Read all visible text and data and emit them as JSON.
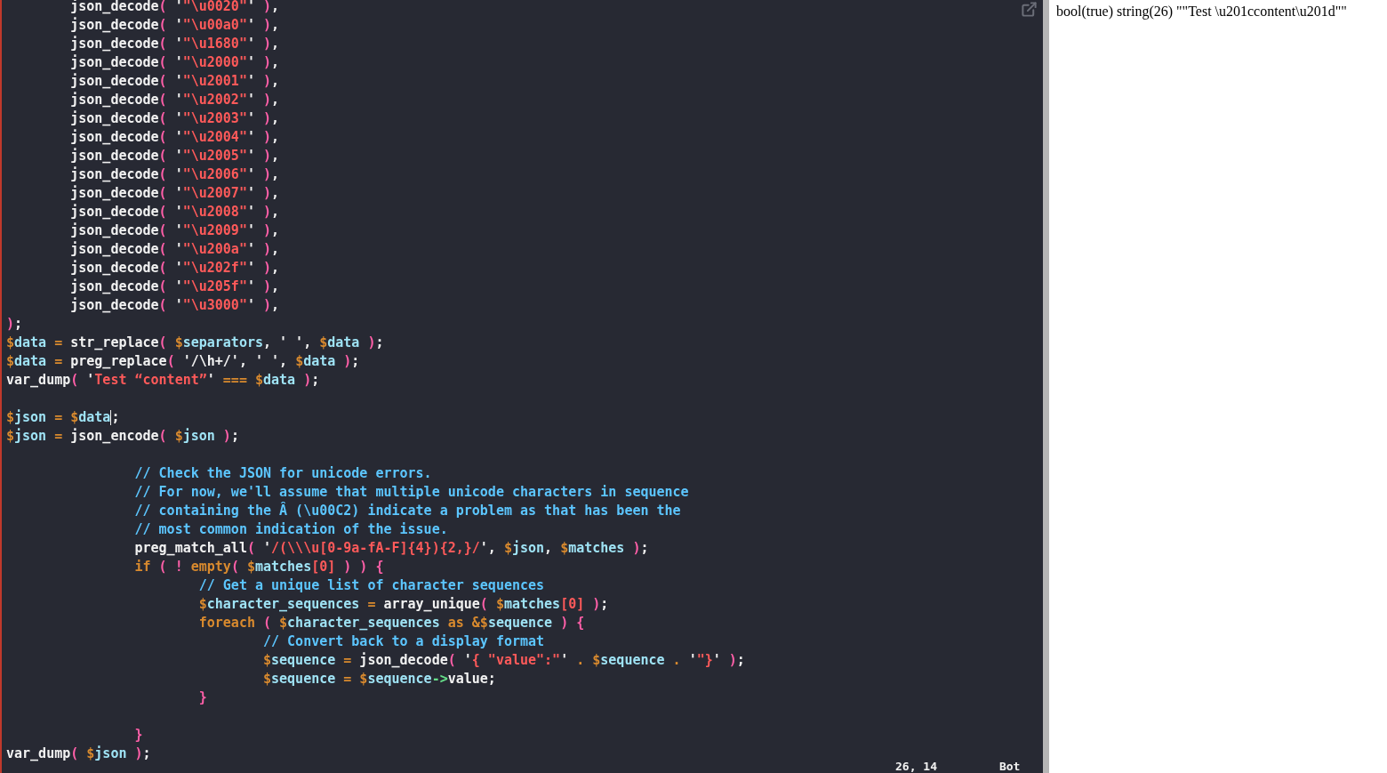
{
  "editor": {
    "lines": [
      {
        "tokens": [
          {
            "kind": "fn",
            "text": "\tjson_decode"
          },
          {
            "kind": "p",
            "text": "("
          },
          {
            "kind": "plain",
            "text": " '"
          },
          {
            "kind": "s",
            "text": "\"\\u0020\""
          },
          {
            "kind": "plain",
            "text": "' "
          },
          {
            "kind": "p",
            "text": ")"
          },
          {
            "kind": "plain",
            "text": ","
          }
        ]
      },
      {
        "tokens": [
          {
            "kind": "fn",
            "text": "\tjson_decode"
          },
          {
            "kind": "p",
            "text": "("
          },
          {
            "kind": "plain",
            "text": " '"
          },
          {
            "kind": "s",
            "text": "\"\\u00a0\""
          },
          {
            "kind": "plain",
            "text": "' "
          },
          {
            "kind": "p",
            "text": ")"
          },
          {
            "kind": "plain",
            "text": ","
          }
        ]
      },
      {
        "tokens": [
          {
            "kind": "fn",
            "text": "\tjson_decode"
          },
          {
            "kind": "p",
            "text": "("
          },
          {
            "kind": "plain",
            "text": " '"
          },
          {
            "kind": "s",
            "text": "\"\\u1680\""
          },
          {
            "kind": "plain",
            "text": "' "
          },
          {
            "kind": "p",
            "text": ")"
          },
          {
            "kind": "plain",
            "text": ","
          }
        ]
      },
      {
        "tokens": [
          {
            "kind": "fn",
            "text": "\tjson_decode"
          },
          {
            "kind": "p",
            "text": "("
          },
          {
            "kind": "plain",
            "text": " '"
          },
          {
            "kind": "s",
            "text": "\"\\u2000\""
          },
          {
            "kind": "plain",
            "text": "' "
          },
          {
            "kind": "p",
            "text": ")"
          },
          {
            "kind": "plain",
            "text": ","
          }
        ]
      },
      {
        "tokens": [
          {
            "kind": "fn",
            "text": "\tjson_decode"
          },
          {
            "kind": "p",
            "text": "("
          },
          {
            "kind": "plain",
            "text": " '"
          },
          {
            "kind": "s",
            "text": "\"\\u2001\""
          },
          {
            "kind": "plain",
            "text": "' "
          },
          {
            "kind": "p",
            "text": ")"
          },
          {
            "kind": "plain",
            "text": ","
          }
        ]
      },
      {
        "tokens": [
          {
            "kind": "fn",
            "text": "\tjson_decode"
          },
          {
            "kind": "p",
            "text": "("
          },
          {
            "kind": "plain",
            "text": " '"
          },
          {
            "kind": "s",
            "text": "\"\\u2002\""
          },
          {
            "kind": "plain",
            "text": "' "
          },
          {
            "kind": "p",
            "text": ")"
          },
          {
            "kind": "plain",
            "text": ","
          }
        ]
      },
      {
        "tokens": [
          {
            "kind": "fn",
            "text": "\tjson_decode"
          },
          {
            "kind": "p",
            "text": "("
          },
          {
            "kind": "plain",
            "text": " '"
          },
          {
            "kind": "s",
            "text": "\"\\u2003\""
          },
          {
            "kind": "plain",
            "text": "' "
          },
          {
            "kind": "p",
            "text": ")"
          },
          {
            "kind": "plain",
            "text": ","
          }
        ]
      },
      {
        "tokens": [
          {
            "kind": "fn",
            "text": "\tjson_decode"
          },
          {
            "kind": "p",
            "text": "("
          },
          {
            "kind": "plain",
            "text": " '"
          },
          {
            "kind": "s",
            "text": "\"\\u2004\""
          },
          {
            "kind": "plain",
            "text": "' "
          },
          {
            "kind": "p",
            "text": ")"
          },
          {
            "kind": "plain",
            "text": ","
          }
        ]
      },
      {
        "tokens": [
          {
            "kind": "fn",
            "text": "\tjson_decode"
          },
          {
            "kind": "p",
            "text": "("
          },
          {
            "kind": "plain",
            "text": " '"
          },
          {
            "kind": "s",
            "text": "\"\\u2005\""
          },
          {
            "kind": "plain",
            "text": "' "
          },
          {
            "kind": "p",
            "text": ")"
          },
          {
            "kind": "plain",
            "text": ","
          }
        ]
      },
      {
        "tokens": [
          {
            "kind": "fn",
            "text": "\tjson_decode"
          },
          {
            "kind": "p",
            "text": "("
          },
          {
            "kind": "plain",
            "text": " '"
          },
          {
            "kind": "s",
            "text": "\"\\u2006\""
          },
          {
            "kind": "plain",
            "text": "' "
          },
          {
            "kind": "p",
            "text": ")"
          },
          {
            "kind": "plain",
            "text": ","
          }
        ]
      },
      {
        "tokens": [
          {
            "kind": "fn",
            "text": "\tjson_decode"
          },
          {
            "kind": "p",
            "text": "("
          },
          {
            "kind": "plain",
            "text": " '"
          },
          {
            "kind": "s",
            "text": "\"\\u2007\""
          },
          {
            "kind": "plain",
            "text": "' "
          },
          {
            "kind": "p",
            "text": ")"
          },
          {
            "kind": "plain",
            "text": ","
          }
        ]
      },
      {
        "tokens": [
          {
            "kind": "fn",
            "text": "\tjson_decode"
          },
          {
            "kind": "p",
            "text": "("
          },
          {
            "kind": "plain",
            "text": " '"
          },
          {
            "kind": "s",
            "text": "\"\\u2008\""
          },
          {
            "kind": "plain",
            "text": "' "
          },
          {
            "kind": "p",
            "text": ")"
          },
          {
            "kind": "plain",
            "text": ","
          }
        ]
      },
      {
        "tokens": [
          {
            "kind": "fn",
            "text": "\tjson_decode"
          },
          {
            "kind": "p",
            "text": "("
          },
          {
            "kind": "plain",
            "text": " '"
          },
          {
            "kind": "s",
            "text": "\"\\u2009\""
          },
          {
            "kind": "plain",
            "text": "' "
          },
          {
            "kind": "p",
            "text": ")"
          },
          {
            "kind": "plain",
            "text": ","
          }
        ]
      },
      {
        "tokens": [
          {
            "kind": "fn",
            "text": "\tjson_decode"
          },
          {
            "kind": "p",
            "text": "("
          },
          {
            "kind": "plain",
            "text": " '"
          },
          {
            "kind": "s",
            "text": "\"\\u200a\""
          },
          {
            "kind": "plain",
            "text": "' "
          },
          {
            "kind": "p",
            "text": ")"
          },
          {
            "kind": "plain",
            "text": ","
          }
        ]
      },
      {
        "tokens": [
          {
            "kind": "fn",
            "text": "\tjson_decode"
          },
          {
            "kind": "p",
            "text": "("
          },
          {
            "kind": "plain",
            "text": " '"
          },
          {
            "kind": "s",
            "text": "\"\\u202f\""
          },
          {
            "kind": "plain",
            "text": "' "
          },
          {
            "kind": "p",
            "text": ")"
          },
          {
            "kind": "plain",
            "text": ","
          }
        ]
      },
      {
        "tokens": [
          {
            "kind": "fn",
            "text": "\tjson_decode"
          },
          {
            "kind": "p",
            "text": "("
          },
          {
            "kind": "plain",
            "text": " '"
          },
          {
            "kind": "s",
            "text": "\"\\u205f\""
          },
          {
            "kind": "plain",
            "text": "' "
          },
          {
            "kind": "p",
            "text": ")"
          },
          {
            "kind": "plain",
            "text": ","
          }
        ]
      },
      {
        "tokens": [
          {
            "kind": "fn",
            "text": "\tjson_decode"
          },
          {
            "kind": "p",
            "text": "("
          },
          {
            "kind": "plain",
            "text": " '"
          },
          {
            "kind": "s",
            "text": "\"\\u3000\""
          },
          {
            "kind": "plain",
            "text": "' "
          },
          {
            "kind": "p",
            "text": ")"
          },
          {
            "kind": "plain",
            "text": ","
          }
        ]
      },
      {
        "tokens": [
          {
            "kind": "p",
            "text": ")"
          },
          {
            "kind": "plain",
            "text": ";"
          }
        ]
      },
      {
        "tokens": [
          {
            "kind": "d",
            "text": "$"
          },
          {
            "kind": "v",
            "text": "data"
          },
          {
            "kind": "o",
            "text": " = "
          },
          {
            "kind": "fn",
            "text": "str_replace"
          },
          {
            "kind": "p",
            "text": "("
          },
          {
            "kind": "d",
            "text": " $"
          },
          {
            "kind": "v",
            "text": "separators"
          },
          {
            "kind": "plain",
            "text": ", ' ', "
          },
          {
            "kind": "d",
            "text": "$"
          },
          {
            "kind": "v",
            "text": "data"
          },
          {
            "kind": "p",
            "text": " )"
          },
          {
            "kind": "plain",
            "text": ";"
          }
        ]
      },
      {
        "tokens": [
          {
            "kind": "d",
            "text": "$"
          },
          {
            "kind": "v",
            "text": "data"
          },
          {
            "kind": "o",
            "text": " = "
          },
          {
            "kind": "fn",
            "text": "preg_replace"
          },
          {
            "kind": "p",
            "text": "("
          },
          {
            "kind": "plain",
            "text": " '/\\h+/', ' ', "
          },
          {
            "kind": "d",
            "text": "$"
          },
          {
            "kind": "v",
            "text": "data"
          },
          {
            "kind": "p",
            "text": " )"
          },
          {
            "kind": "plain",
            "text": ";"
          }
        ]
      },
      {
        "tokens": [
          {
            "kind": "fn",
            "text": "var_dump"
          },
          {
            "kind": "p",
            "text": "("
          },
          {
            "kind": "plain",
            "text": " '"
          },
          {
            "kind": "s",
            "text": "Test “content”"
          },
          {
            "kind": "plain",
            "text": "' "
          },
          {
            "kind": "o",
            "text": "==="
          },
          {
            "kind": "d",
            "text": " $"
          },
          {
            "kind": "v",
            "text": "data"
          },
          {
            "kind": "p",
            "text": " )"
          },
          {
            "kind": "plain",
            "text": ";"
          }
        ]
      },
      {
        "kind": "blank"
      },
      {
        "tokens": [
          {
            "kind": "d",
            "text": "$"
          },
          {
            "kind": "v",
            "text": "json"
          },
          {
            "kind": "o",
            "text": " = "
          },
          {
            "kind": "d",
            "text": "$"
          },
          {
            "kind": "v",
            "text": "data"
          },
          {
            "kind": "cursor"
          },
          {
            "kind": "plain",
            "text": ";"
          }
        ]
      },
      {
        "tokens": [
          {
            "kind": "d",
            "text": "$"
          },
          {
            "kind": "v",
            "text": "json"
          },
          {
            "kind": "o",
            "text": " = "
          },
          {
            "kind": "fn",
            "text": "json_encode"
          },
          {
            "kind": "p",
            "text": "("
          },
          {
            "kind": "d",
            "text": " $"
          },
          {
            "kind": "v",
            "text": "json"
          },
          {
            "kind": "p",
            "text": " )"
          },
          {
            "kind": "plain",
            "text": ";"
          }
        ]
      },
      {
        "kind": "blank"
      },
      {
        "tokens": [
          {
            "kind": "c",
            "text": "\t\t// Check the JSON for unicode errors."
          }
        ]
      },
      {
        "tokens": [
          {
            "kind": "c",
            "text": "\t\t// For now, we'll assume that multiple unicode characters in sequence"
          }
        ]
      },
      {
        "tokens": [
          {
            "kind": "c",
            "text": "\t\t// containing the Â (\\u00C2) indicate a problem as that has been the"
          }
        ]
      },
      {
        "tokens": [
          {
            "kind": "c",
            "text": "\t\t// most common indication of the issue."
          }
        ]
      },
      {
        "tokens": [
          {
            "kind": "fn",
            "text": "\t\tpreg_match_all"
          },
          {
            "kind": "p",
            "text": "("
          },
          {
            "kind": "plain",
            "text": " '"
          },
          {
            "kind": "s",
            "text": "/(\\\\\\u[0-9a-fA-F]{4}){2,}/"
          },
          {
            "kind": "plain",
            "text": "', "
          },
          {
            "kind": "d",
            "text": "$"
          },
          {
            "kind": "v",
            "text": "json"
          },
          {
            "kind": "plain",
            "text": ", "
          },
          {
            "kind": "d",
            "text": "$"
          },
          {
            "kind": "v",
            "text": "matches"
          },
          {
            "kind": "p",
            "text": " )"
          },
          {
            "kind": "plain",
            "text": ";"
          }
        ]
      },
      {
        "tokens": [
          {
            "kind": "kw",
            "text": "\t\tif"
          },
          {
            "kind": "p",
            "text": " ( ! "
          },
          {
            "kind": "kw",
            "text": "empty"
          },
          {
            "kind": "p",
            "text": "("
          },
          {
            "kind": "d",
            "text": " $"
          },
          {
            "kind": "v",
            "text": "matches"
          },
          {
            "kind": "n",
            "text": "[0]"
          },
          {
            "kind": "p",
            "text": " ) ) {"
          }
        ]
      },
      {
        "tokens": [
          {
            "kind": "c",
            "text": "\t\t\t// Get a unique list of character sequences"
          }
        ]
      },
      {
        "tokens": [
          {
            "kind": "d",
            "text": "\t\t\t$"
          },
          {
            "kind": "v",
            "text": "character_sequences"
          },
          {
            "kind": "o",
            "text": " = "
          },
          {
            "kind": "fn",
            "text": "array_unique"
          },
          {
            "kind": "p",
            "text": "("
          },
          {
            "kind": "d",
            "text": " $"
          },
          {
            "kind": "v",
            "text": "matches"
          },
          {
            "kind": "n",
            "text": "[0]"
          },
          {
            "kind": "p",
            "text": " )"
          },
          {
            "kind": "plain",
            "text": ";"
          }
        ]
      },
      {
        "tokens": [
          {
            "kind": "kw",
            "text": "\t\t\tforeach"
          },
          {
            "kind": "p",
            "text": " ("
          },
          {
            "kind": "d",
            "text": " $"
          },
          {
            "kind": "v",
            "text": "character_sequences"
          },
          {
            "kind": "kw",
            "text": " as "
          },
          {
            "kind": "o",
            "text": "&"
          },
          {
            "kind": "d",
            "text": "$"
          },
          {
            "kind": "v",
            "text": "sequence"
          },
          {
            "kind": "p",
            "text": " ) {"
          }
        ]
      },
      {
        "tokens": [
          {
            "kind": "c",
            "text": "\t\t\t\t// Convert back to a display format"
          }
        ]
      },
      {
        "tokens": [
          {
            "kind": "d",
            "text": "\t\t\t\t$"
          },
          {
            "kind": "v",
            "text": "sequence"
          },
          {
            "kind": "o",
            "text": " = "
          },
          {
            "kind": "fn",
            "text": "json_decode"
          },
          {
            "kind": "p",
            "text": "("
          },
          {
            "kind": "plain",
            "text": " '"
          },
          {
            "kind": "s",
            "text": "{ \"value\":\""
          },
          {
            "kind": "plain",
            "text": "' "
          },
          {
            "kind": "o",
            "text": ". "
          },
          {
            "kind": "d",
            "text": "$"
          },
          {
            "kind": "v",
            "text": "sequence"
          },
          {
            "kind": "o",
            "text": " . "
          },
          {
            "kind": "plain",
            "text": "'"
          },
          {
            "kind": "s",
            "text": "\"}"
          },
          {
            "kind": "plain",
            "text": "' "
          },
          {
            "kind": "p",
            "text": ")"
          },
          {
            "kind": "plain",
            "text": ";"
          }
        ]
      },
      {
        "tokens": [
          {
            "kind": "d",
            "text": "\t\t\t\t$"
          },
          {
            "kind": "v",
            "text": "sequence"
          },
          {
            "kind": "o",
            "text": " = "
          },
          {
            "kind": "d",
            "text": "$"
          },
          {
            "kind": "v",
            "text": "sequence"
          },
          {
            "kind": "a",
            "text": "->"
          },
          {
            "kind": "plain",
            "text": "value;"
          }
        ]
      },
      {
        "tokens": [
          {
            "kind": "p",
            "text": "\t\t\t}"
          }
        ]
      },
      {
        "kind": "blank"
      },
      {
        "tokens": [
          {
            "kind": "p",
            "text": "\t\t}"
          }
        ]
      },
      {
        "tokens": [
          {
            "kind": "fn",
            "text": "var_dump"
          },
          {
            "kind": "p",
            "text": "("
          },
          {
            "kind": "d",
            "text": " $"
          },
          {
            "kind": "v",
            "text": "json"
          },
          {
            "kind": "p",
            "text": " )"
          },
          {
            "kind": "plain",
            "text": ";"
          }
        ]
      }
    ],
    "status": {
      "position": "26, 14",
      "scroll": "Bot"
    }
  },
  "output": {
    "text": "bool(true) string(26) \"\"Test \\u201ccontent\\u201d\"\""
  }
}
